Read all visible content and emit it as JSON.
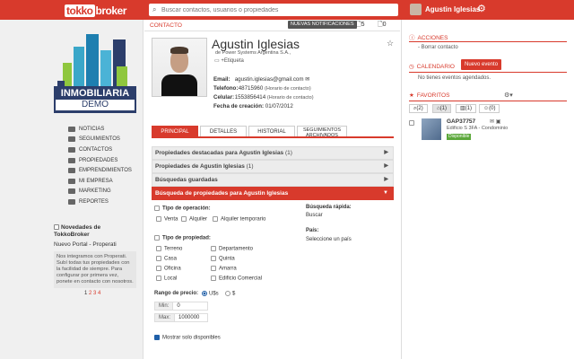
{
  "topbar": {
    "logo_badge": "tokko",
    "logo_rest": "broker",
    "search_placeholder": "Buscar contactos, usuarios o propiedades",
    "user_name": "Agustin Iglesias"
  },
  "sidebar": {
    "brand_line1": "INMOBILIARIA",
    "brand_line2": "DEMO",
    "nav": [
      {
        "label": "NOTICIAS"
      },
      {
        "label": "SEGUIMIENTOS"
      },
      {
        "label": "CONTACTOS"
      },
      {
        "label": "PROPIEDADES"
      },
      {
        "label": "EMPRENDIMIENTOS"
      },
      {
        "label": "MI EMPRESA"
      },
      {
        "label": "MARKETING"
      },
      {
        "label": "REPORTES"
      }
    ],
    "news_title": "Novedades de TokkoBroker",
    "news_subtitle": "Nuevo Portal - Properati",
    "news_body": "Nos integramos con Properati. Subí todas tus propiedades con la facilidad de siempre. Para configurar por primera vez, ponete en contacto con nosotros.",
    "pager": [
      "1",
      "2",
      "3",
      "4"
    ]
  },
  "main": {
    "breadcrumb": "CONTACTO",
    "notif_badge": "NUEVAS NOTIFICACIONES",
    "count_a": "5",
    "count_b": "0",
    "contact_name": "Agustin Iglesias",
    "company": "de Power Systems Argentina S.A.,",
    "tag_label": "+Etiqueta",
    "info": {
      "email_label": "Email:",
      "email": "agustin.iglesias@gmail.com",
      "phone_label": "Telefono:",
      "phone": "48715960",
      "phone_note": "(Horario de contacto)",
      "cell_label": "Celular:",
      "cell": "1553856414",
      "cell_note": "(Horario de contacto)",
      "created_label": "Fecha de creación:",
      "created": "01/07/2012"
    },
    "tabs": [
      {
        "label": "PRINCIPAL"
      },
      {
        "label": "DETALLES"
      },
      {
        "label": "HISTORIAL"
      },
      {
        "label": "SEGUIMIENTOS ARCHIVADOS"
      }
    ],
    "accordions": [
      {
        "title": "Propiedades destacadas para Agustin Iglesias",
        "count": "(1)"
      },
      {
        "title": "Propiedades de Agustin Iglesias",
        "count": "(1)"
      },
      {
        "title": "Búsquedas guardadas",
        "count": ""
      },
      {
        "title": "Búsqueda de propiedades para Agustin Iglesias",
        "count": ""
      }
    ],
    "form": {
      "operation_label": "Tipo de operación:",
      "op_venta": "Venta",
      "op_alquiler": "Alquiler",
      "op_temporario": "Alquiler temporario",
      "quick_search_label": "Búsqueda rápida:",
      "quick_search_btn": "Buscar",
      "country_label": "País:",
      "country_value": "Seleccione un país",
      "property_type_label": "Tipo de propiedad:",
      "types_left": [
        "Terreno",
        "Casa",
        "Oficina",
        "Local"
      ],
      "types_right": [
        "Departamento",
        "Quinta",
        "Amarra",
        "Edificio Comercial"
      ],
      "price_label": "Rango de precio:",
      "currency_usd": "U$s",
      "currency_ars": "$",
      "min_label": "Min:",
      "min_value": "0",
      "max_label": "Max:",
      "max_value": "1000000",
      "show_available": "Mostrar solo disponibles"
    }
  },
  "right": {
    "actions_title": "ACCIONES",
    "actions_item": "- Borrar contacto",
    "calendar_title": "CALENDARIO",
    "new_event_btn": "Nuevo evento",
    "calendar_empty": "No tienes eventos agendados.",
    "favorites_title": "FAVORITOS",
    "fav_tabs": [
      {
        "label": "(2)"
      },
      {
        "label": "(1)"
      },
      {
        "label": "(1)"
      },
      {
        "label": "(0)"
      }
    ],
    "fav": {
      "id": "GAP37757",
      "desc": "Edificio S 3FA - Condominio",
      "badge": "Disponible"
    }
  },
  "colors": {
    "brand_red": "#d83a2c",
    "checkbox_blue": "#1f5fa8",
    "logo_navy": "#2c3e6b"
  }
}
